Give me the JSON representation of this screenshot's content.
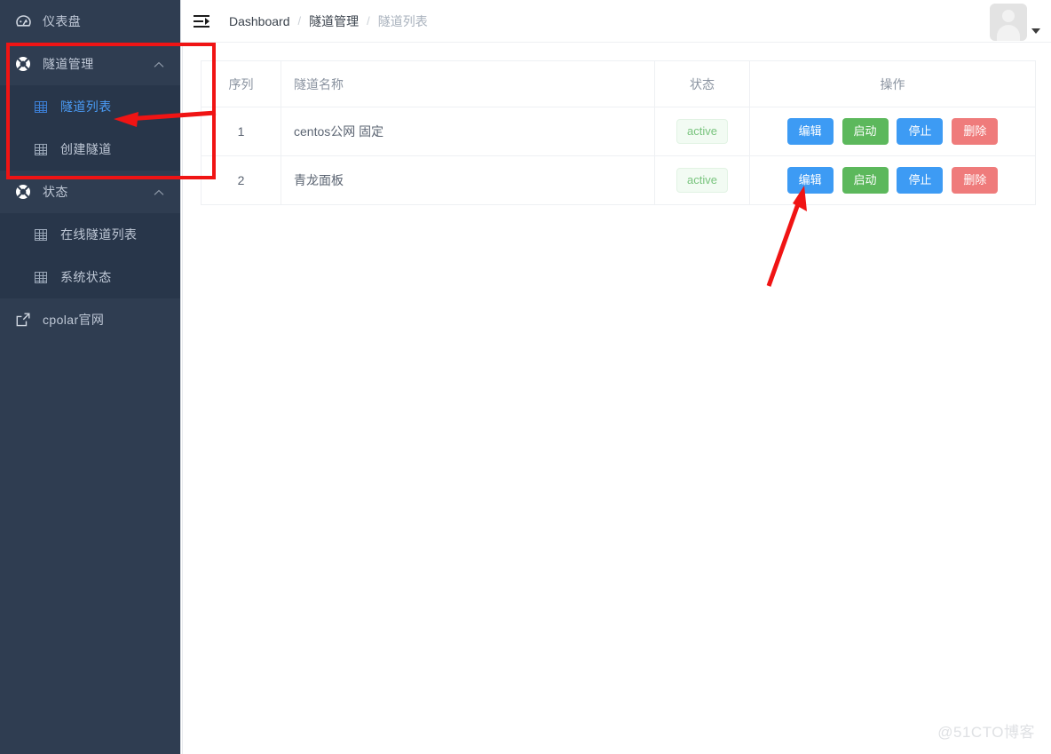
{
  "colors": {
    "sidebar_bg": "#2f3d51",
    "sidebar_sub_bg": "#28364a",
    "active_blue": "#4a9bf5",
    "btn_blue": "#3d9bf4",
    "btn_green": "#5cb85c",
    "btn_red": "#ef7b7b",
    "badge_green_text": "#79c47e",
    "annotation_red": "#f01414"
  },
  "sidebar": {
    "items": [
      {
        "label": "仪表盘",
        "icon": "dashboard-icon",
        "type": "top",
        "active": false,
        "collapsible": false
      },
      {
        "label": "隧道管理",
        "icon": "lifebuoy-icon",
        "type": "top",
        "active": false,
        "collapsible": true,
        "chevron": "chevron-up-icon"
      },
      {
        "label": "隧道列表",
        "icon": "table-icon",
        "type": "sub",
        "active": true
      },
      {
        "label": "创建隧道",
        "icon": "table-icon",
        "type": "sub",
        "active": false
      },
      {
        "label": "状态",
        "icon": "lifebuoy-icon",
        "type": "top",
        "active": false,
        "collapsible": true,
        "chevron": "chevron-up-icon"
      },
      {
        "label": "在线隧道列表",
        "icon": "table-icon",
        "type": "sub",
        "active": false
      },
      {
        "label": "系统状态",
        "icon": "table-icon",
        "type": "sub",
        "active": false
      },
      {
        "label": "cpolar官网",
        "icon": "external-link-icon",
        "type": "top",
        "active": false,
        "collapsible": false
      }
    ]
  },
  "header": {
    "fold_icon": "menu-fold-icon",
    "breadcrumb": [
      {
        "label": "Dashboard",
        "current": false
      },
      {
        "label": "隧道管理",
        "current": false
      },
      {
        "label": "隧道列表",
        "current": true
      }
    ],
    "separator": "/",
    "avatar": "user-avatar-placeholder",
    "caret": "caret-down-icon"
  },
  "table": {
    "columns": [
      {
        "key": "seq",
        "label": "序列"
      },
      {
        "key": "name",
        "label": "隧道名称"
      },
      {
        "key": "status",
        "label": "状态"
      },
      {
        "key": "action",
        "label": "操作"
      }
    ],
    "rows": [
      {
        "seq": "1",
        "name": "centos公网 固定",
        "status": "active",
        "actions": [
          "编辑",
          "启动",
          "停止",
          "删除"
        ]
      },
      {
        "seq": "2",
        "name": "青龙面板",
        "status": "active",
        "actions": [
          "编辑",
          "启动",
          "停止",
          "删除"
        ]
      }
    ],
    "action_labels": {
      "edit": "编辑",
      "start": "启动",
      "stop": "停止",
      "delete": "删除"
    }
  },
  "watermark": {
    "text": "@51CTO博客"
  }
}
